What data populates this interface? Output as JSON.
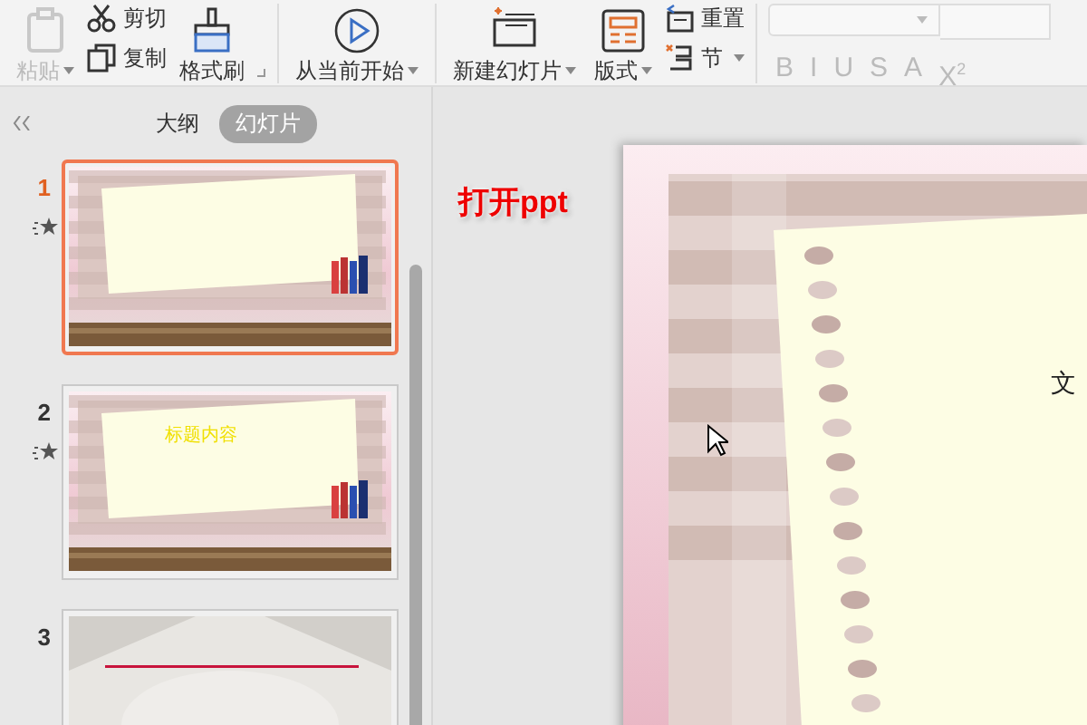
{
  "toolbar": {
    "paste": {
      "label": "粘贴",
      "disabled": true
    },
    "cut": {
      "label": "剪切"
    },
    "copy": {
      "label": "复制"
    },
    "format_painter": {
      "label": "格式刷"
    },
    "play": {
      "label": "从当前开始"
    },
    "new_slide": {
      "label": "新建幻灯片"
    },
    "layout": {
      "label": "版式"
    },
    "reset": {
      "label": "重置"
    },
    "section": {
      "label": "节"
    },
    "font_buttons": [
      {
        "label": "B",
        "disabled": true
      },
      {
        "label": "I",
        "disabled": true
      },
      {
        "label": "U",
        "disabled": true
      },
      {
        "label": "S",
        "disabled": true
      },
      {
        "label": "A",
        "disabled": true
      },
      {
        "label": "X$^{2}$",
        "disabled": true
      }
    ]
  },
  "pane": {
    "tabs": [
      {
        "label": "大纲",
        "selected": false
      },
      {
        "label": "幻灯片",
        "selected": true
      }
    ],
    "slides": [
      {
        "number": "1",
        "selected": true,
        "animated": true,
        "kind": "notebook"
      },
      {
        "number": "2",
        "selected": false,
        "animated": true,
        "kind": "notebook",
        "title": "标题内容"
      },
      {
        "number": "3",
        "selected": false,
        "animated": false,
        "kind": "room"
      }
    ]
  },
  "editor": {
    "annotation": "打开ppt",
    "slide_text": "文"
  }
}
